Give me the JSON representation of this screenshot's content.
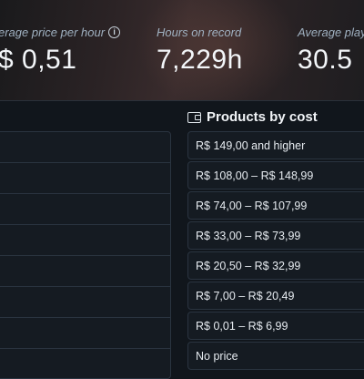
{
  "stats": [
    {
      "label": "erage price per hour",
      "value": "$ 0,51"
    },
    {
      "label": "Hours on record",
      "value": "7,229h"
    },
    {
      "label": "Average play",
      "value": "30.5"
    }
  ],
  "products_section": {
    "title": "Products by cost",
    "items": [
      "R$ 149,00 and higher",
      "R$ 108,00 – R$ 148,99",
      "R$ 74,00 – R$ 107,99",
      "R$ 33,00 – R$ 73,99",
      "R$ 20,50 – R$ 32,99",
      "R$ 7,00 – R$ 20,49",
      "R$ 0,01 – R$ 6,99",
      "No price"
    ]
  },
  "icons": {
    "info": "info-icon",
    "wallet": "wallet-icon"
  }
}
